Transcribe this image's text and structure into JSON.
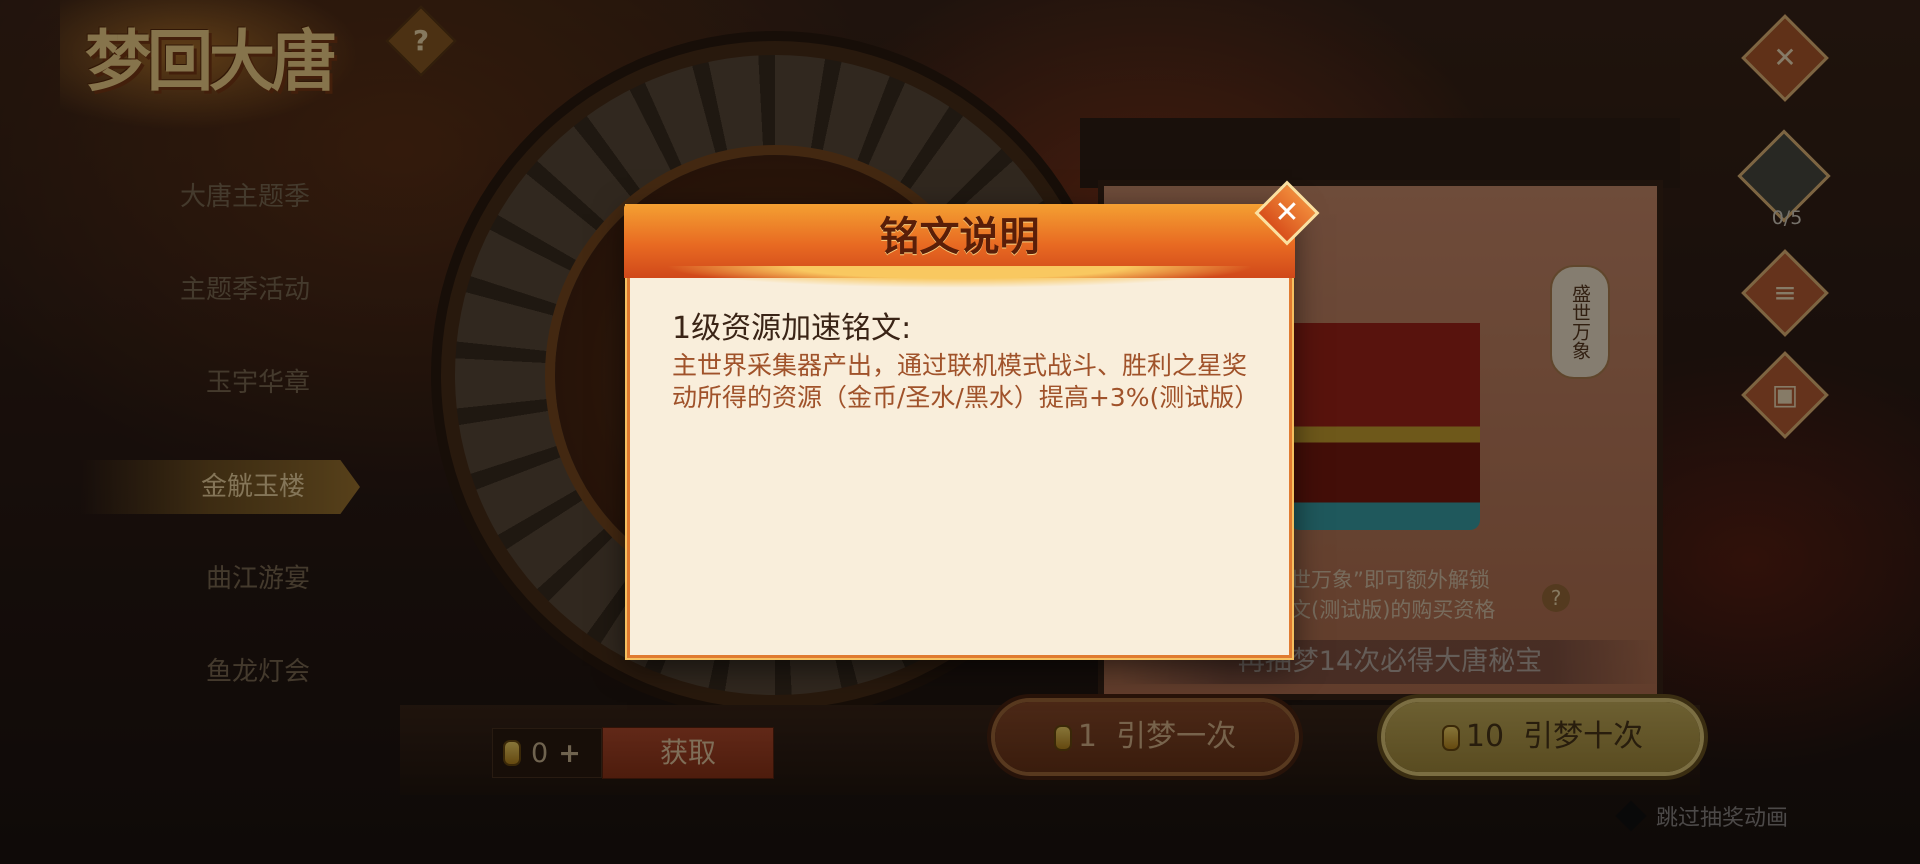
{
  "logo": {
    "text": "梦回大唐"
  },
  "sidebar": {
    "items": [
      {
        "label": "大唐主题季",
        "active": false
      },
      {
        "label": "主题季活动",
        "active": false
      },
      {
        "label": "玉宇华章",
        "active": false
      },
      {
        "label": "金觥玉楼",
        "active": true
      },
      {
        "label": "曲江游宴",
        "active": false
      },
      {
        "label": "鱼龙灯会",
        "active": false
      }
    ]
  },
  "top": {
    "help_symbol": "?",
    "close_symbol": "✕"
  },
  "panel": {
    "scroll_tag": "盛世万象",
    "unlock_line1": "世万象”即可额外解锁",
    "unlock_line2": "文(测试版)的购买资格",
    "help_symbol": "?",
    "pity_text": "再抽梦14次必得大唐秘宝"
  },
  "right_icons": {
    "jar_count": "0/5",
    "task_icon": "task-icon",
    "gift_icon": "gift-icon"
  },
  "bottom": {
    "currency_count": "0",
    "plus": "+",
    "get_label": "获取",
    "draw_one_cost": "1",
    "draw_one_label": "引梦一次",
    "draw_ten_cost": "10",
    "draw_ten_label": "引梦十次",
    "skip_label": "跳过抽奖动画"
  },
  "modal": {
    "title": "铭文说明",
    "close_symbol": "✕",
    "heading": "1级资源加速铭文:",
    "body": "主世界采集器产出，通过联机模式战斗、胜利之星奖动所得的资源（金币/圣水/黑水）提高+3%(测试版）"
  },
  "colors": {
    "accent_orange": "#e86a22",
    "modal_bg": "#f9eedb",
    "body_text": "#a0522a"
  }
}
